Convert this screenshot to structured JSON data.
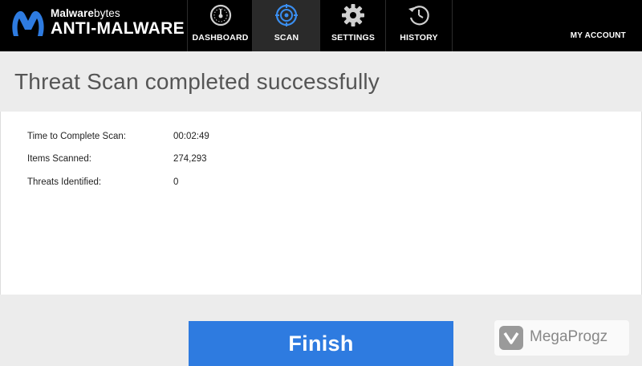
{
  "brand": {
    "name_bold": "Malware",
    "name_thin": "bytes",
    "product": "ANTI-MALWARE"
  },
  "nav": {
    "tabs": [
      {
        "label": "DASHBOARD",
        "icon": "speedometer-icon"
      },
      {
        "label": "SCAN",
        "icon": "target-icon",
        "active": true
      },
      {
        "label": "SETTINGS",
        "icon": "gear-icon"
      },
      {
        "label": "HISTORY",
        "icon": "clock-history-icon"
      }
    ],
    "account": "MY ACCOUNT"
  },
  "header": {
    "title": "Threat Scan completed successfully"
  },
  "results": [
    {
      "label": "Time to Complete Scan:",
      "value": "00:02:49"
    },
    {
      "label": "Items Scanned:",
      "value": "274,293"
    },
    {
      "label": "Threats Identified:",
      "value": "0"
    }
  ],
  "footer": {
    "finish_label": "Finish",
    "watermark": "MegaProgz"
  },
  "colors": {
    "accent_blue": "#2e7be0",
    "scan_icon_blue": "#3a8ef0",
    "topbar": "#000000",
    "active_tab": "#2a2a2a"
  }
}
